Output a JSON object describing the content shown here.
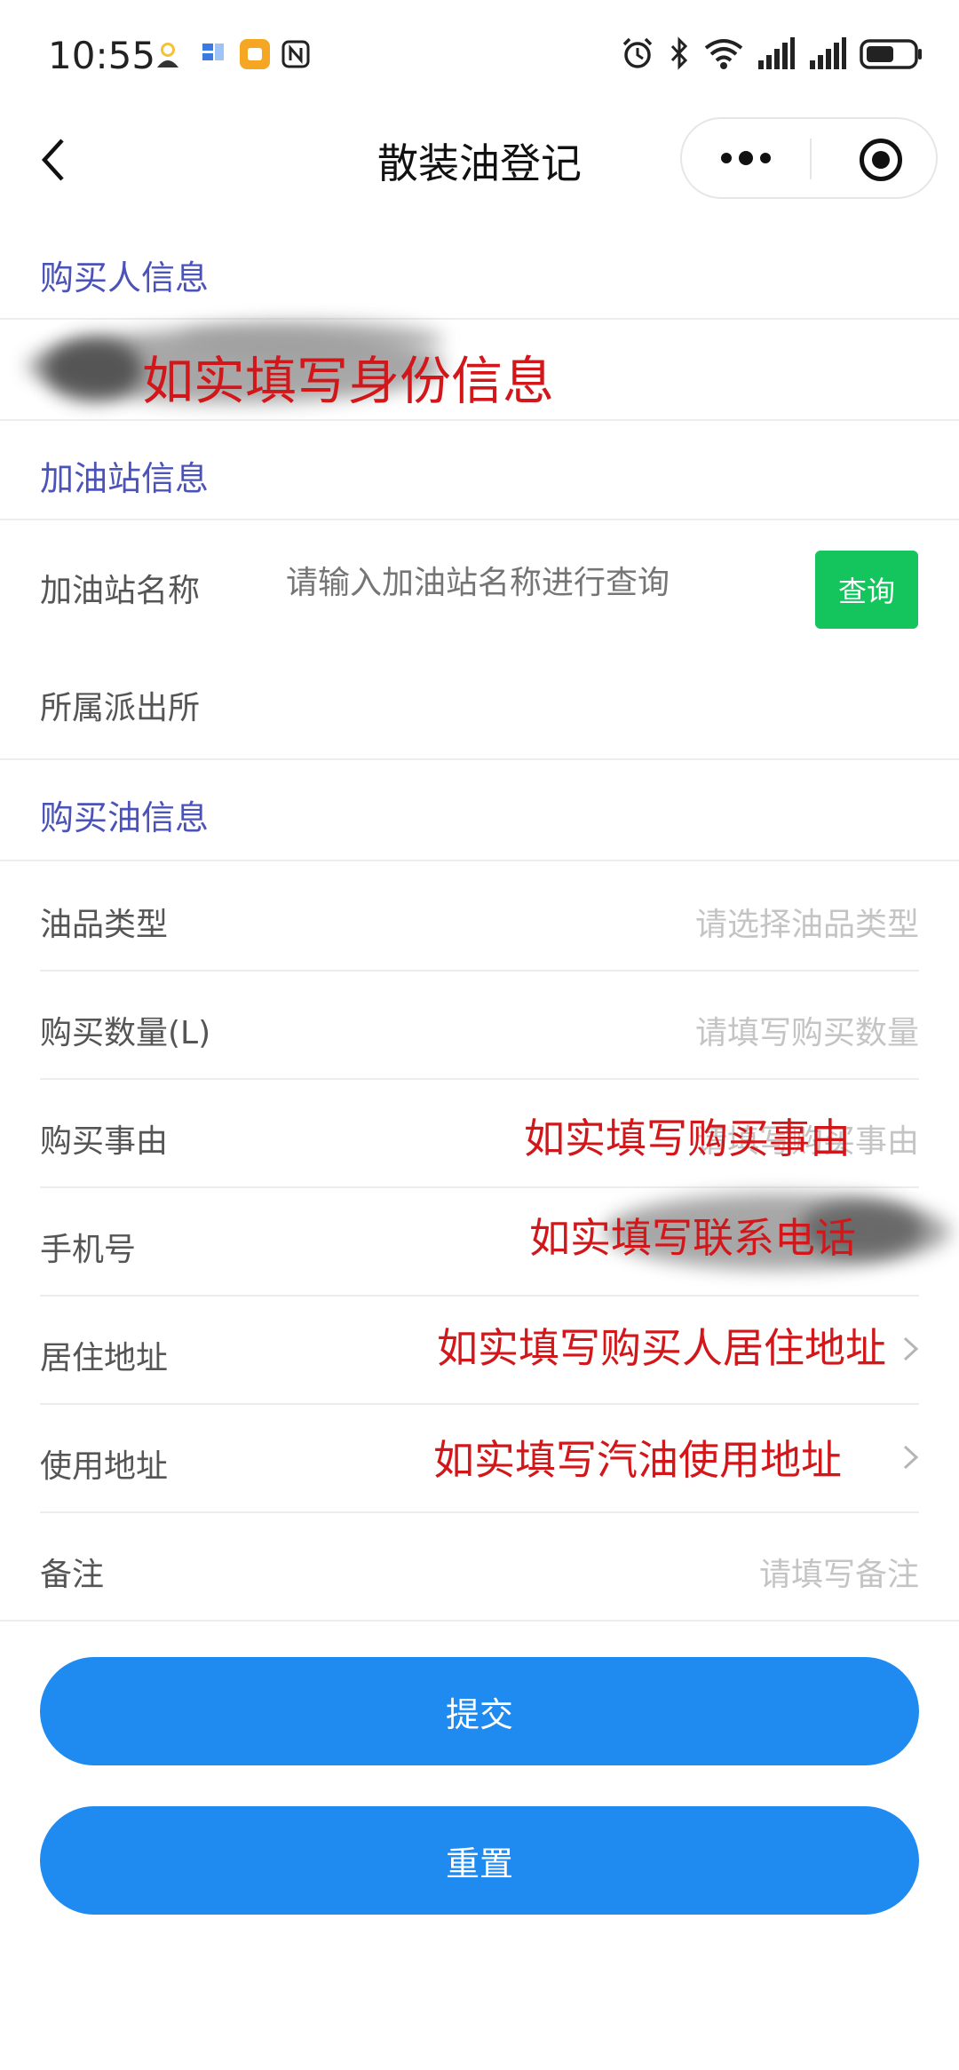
{
  "status_bar": {
    "time": "10:55",
    "notification_icons": [
      "avatar-icon",
      "storage-icon",
      "app-icon",
      "nfc-icon"
    ],
    "right_icons": [
      "alarm-icon",
      "bluetooth-icon",
      "wifi-icon",
      "signal-icon",
      "signal-icon",
      "battery-icon"
    ]
  },
  "nav": {
    "title": "散装油登记"
  },
  "sections": {
    "buyer": {
      "title": "购买人信息"
    },
    "station": {
      "title": "加油站信息"
    },
    "oil": {
      "title": "购买油信息"
    }
  },
  "annotations": {
    "identity": "如实填写身份信息",
    "reason": "如实填写购买事由",
    "phone": "如实填写联系电话",
    "residence": "如实填写购买人居住地址",
    "usage": "如实填写汽油使用地址"
  },
  "station_fields": {
    "name_label": "加油站名称",
    "name_placeholder": "请输入加油站名称进行查询",
    "query_label": "查询",
    "police_label": "所属派出所"
  },
  "oil_fields": {
    "type_label": "油品类型",
    "type_placeholder": "请选择油品类型",
    "quantity_label": "购买数量(L)",
    "quantity_placeholder": "请填写购买数量",
    "reason_label": "购买事由",
    "reason_placeholder": "请填写购买事由",
    "phone_label": "手机号",
    "residence_label": "居住地址",
    "usage_label": "使用地址",
    "remark_label": "备注",
    "remark_placeholder": "请填写备注"
  },
  "buttons": {
    "submit": "提交",
    "reset": "重置"
  },
  "colors": {
    "section_title": "#4b52b8",
    "query_button": "#14c45c",
    "primary_button": "#1f8bf0",
    "annotation": "#d2171b"
  }
}
